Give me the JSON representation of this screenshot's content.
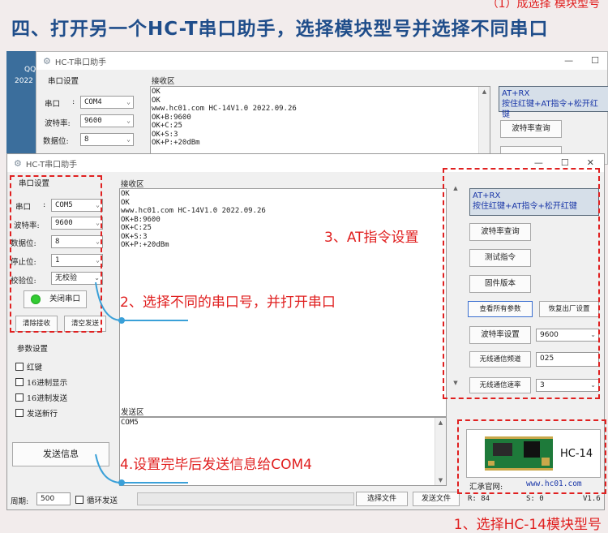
{
  "page": {
    "heading": "四、打开另一个HC-T串口助手，选择模块型号并选择不同串口",
    "top_right_fragment": "（1）成选择        模块型号",
    "bottom_caption": "1、选择HC-14模块型号"
  },
  "desktop": {
    "icon_label_1": "QQ",
    "icon_label_2": "2022"
  },
  "back_window": {
    "title": "HC-T串口助手",
    "serial_group": "串口设置",
    "receive_label": "接收区",
    "port_label": "串口",
    "port_value": "COM4",
    "baud_label": "波特率:",
    "baud_value": "9600",
    "databits_label": "数据位:",
    "databits_value": "8",
    "receive_text": "OK\nOK\nwww.hc01.com HC-14V1.0 2022.09.26\nOK+B:9600\nOK+C:25\nOK+S:3\nOK+P:+20dBm",
    "at_line1": "AT+RX",
    "at_line2": "按住红键+AT指令+松开红键",
    "baud_query": "波特率查询"
  },
  "front_window": {
    "title": "HC-T串口助手",
    "serial_group": "串口设置",
    "port_label": "串口",
    "port_value": "COM5",
    "baud_label": "波特率:",
    "baud_value": "9600",
    "databits_label": "数据位:",
    "databits_value": "8",
    "stopbits_label": "停止位:",
    "stopbits_value": "1",
    "parity_label": "校验位:",
    "parity_value": "无校验",
    "close_port": "关闭串口",
    "clear_receive": "清除接收",
    "clear_send": "清空发送",
    "param_group": "参数设置",
    "checks": [
      "红键",
      "16进制显示",
      "16进制发送",
      "发送新行"
    ],
    "send_button": "发送信息",
    "period_label": "周期:",
    "period_value": "500",
    "loop_send": "循环发送",
    "receive_label": "接收区",
    "receive_text": "OK\nOK\nwww.hc01.com HC-14V1.0 2022.09.26\nOK+B:9600\nOK+C:25\nOK+S:3\nOK+P:+20dBm",
    "send_label": "发送区",
    "send_text": "COM5",
    "at_line1": "AT+RX",
    "at_line2": "按住红键+AT指令+松开红键",
    "baud_query": "波特率查询",
    "test_cmd": "测试指令",
    "firmware": "固件版本",
    "query_all": "查看所有参数",
    "restore": "恢复出厂设置",
    "baud_set": "波特率设置",
    "baud_set_value": "9600",
    "channel_label": "无线通信频道",
    "channel_value": "025",
    "rate_label": "无线通信速率",
    "rate_value": "3",
    "module_name": "HC-14",
    "website_label": "汇承官网:",
    "website": "www.hc01.com",
    "choose_file": "选择文件",
    "send_file": "发送文件",
    "r_count": "R: 84",
    "s_count": "S: 0",
    "version": "V1.6"
  },
  "annotations": {
    "step2": "2、选择不同的串口号，并打开串口",
    "step3": "3、AT指令设置",
    "step4": "4.设置完毕后发送信息给COM4"
  }
}
